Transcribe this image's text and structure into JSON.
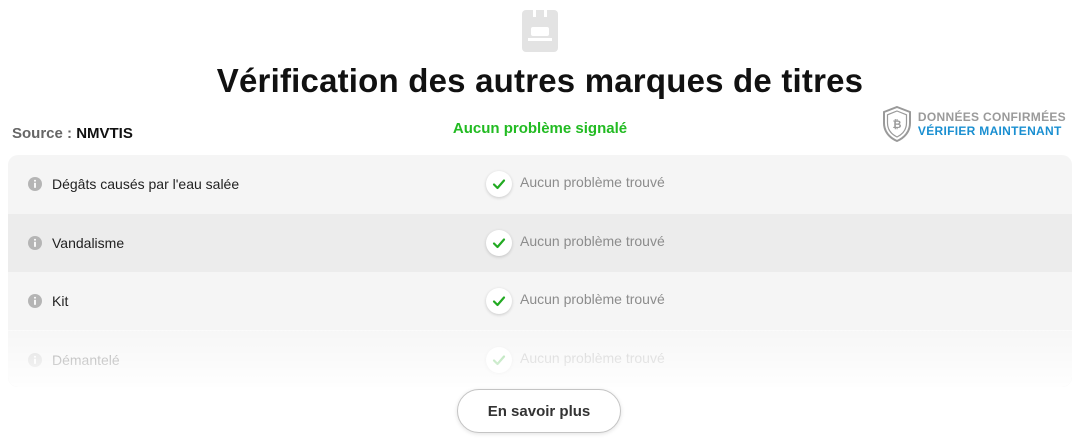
{
  "header": {
    "title": "Vérification des autres marques de titres",
    "icon": "document-report-icon"
  },
  "source": {
    "label": "Source :",
    "value": "NMVTIS"
  },
  "summary": {
    "text": "Aucun problème signalé",
    "color": "#22bb22"
  },
  "badge": {
    "icon": "shield-bitcoin-icon",
    "line1": "DONNÉES CONFIRMÉES",
    "line2": "VÉRIFIER MAINTENANT",
    "accent": "#1a8fd1"
  },
  "checks": [
    {
      "label": "Dégâts causés par l'eau salée",
      "status": "Aucun problème trouvé"
    },
    {
      "label": "Vandalisme",
      "status": "Aucun problème trouvé"
    },
    {
      "label": "Kit",
      "status": "Aucun problème trouvé"
    },
    {
      "label": "Démantelé",
      "status": "Aucun problème trouvé"
    }
  ],
  "check_color": "#22aa22",
  "footer": {
    "more_label": "En savoir plus"
  }
}
